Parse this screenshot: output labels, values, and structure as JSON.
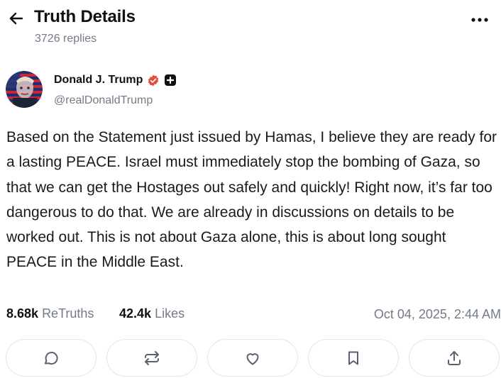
{
  "header": {
    "title": "Truth Details",
    "replies_count": "3726 replies",
    "back_icon": "arrow-left-icon",
    "more_icon": "more-horizontal-icon"
  },
  "author": {
    "name": "Donald J. Trump",
    "handle": "@realDonaldTrump",
    "verified_icon": "verified-badge-icon",
    "verified_color": "#e84c3d",
    "plus_icon": "plus-badge-icon"
  },
  "post": {
    "text": "Based on the Statement just issued by Hamas, I believe they are ready for a lasting PEACE. Israel must immediately stop the bombing of Gaza, so that we can get the Hostages out safely and quickly! Right now, it’s far too dangerous to do that. We are already in discussions on details to be worked out. This is not about Gaza alone, this is about long sought PEACE in the Middle East."
  },
  "stats": {
    "retruths_count": "8.68k",
    "retruths_label": "ReTruths",
    "likes_count": "42.4k",
    "likes_label": "Likes",
    "timestamp": "Oct 04, 2025, 2:44 AM"
  },
  "actions": [
    {
      "name": "reply",
      "icon": "comment-icon"
    },
    {
      "name": "retruth",
      "icon": "repeat-icon"
    },
    {
      "name": "like",
      "icon": "heart-icon"
    },
    {
      "name": "bookmark",
      "icon": "bookmark-icon"
    },
    {
      "name": "share",
      "icon": "share-icon"
    }
  ],
  "colors": {
    "muted_text": "#737b87",
    "border": "#e3e5ea",
    "icon": "#5b6170"
  }
}
